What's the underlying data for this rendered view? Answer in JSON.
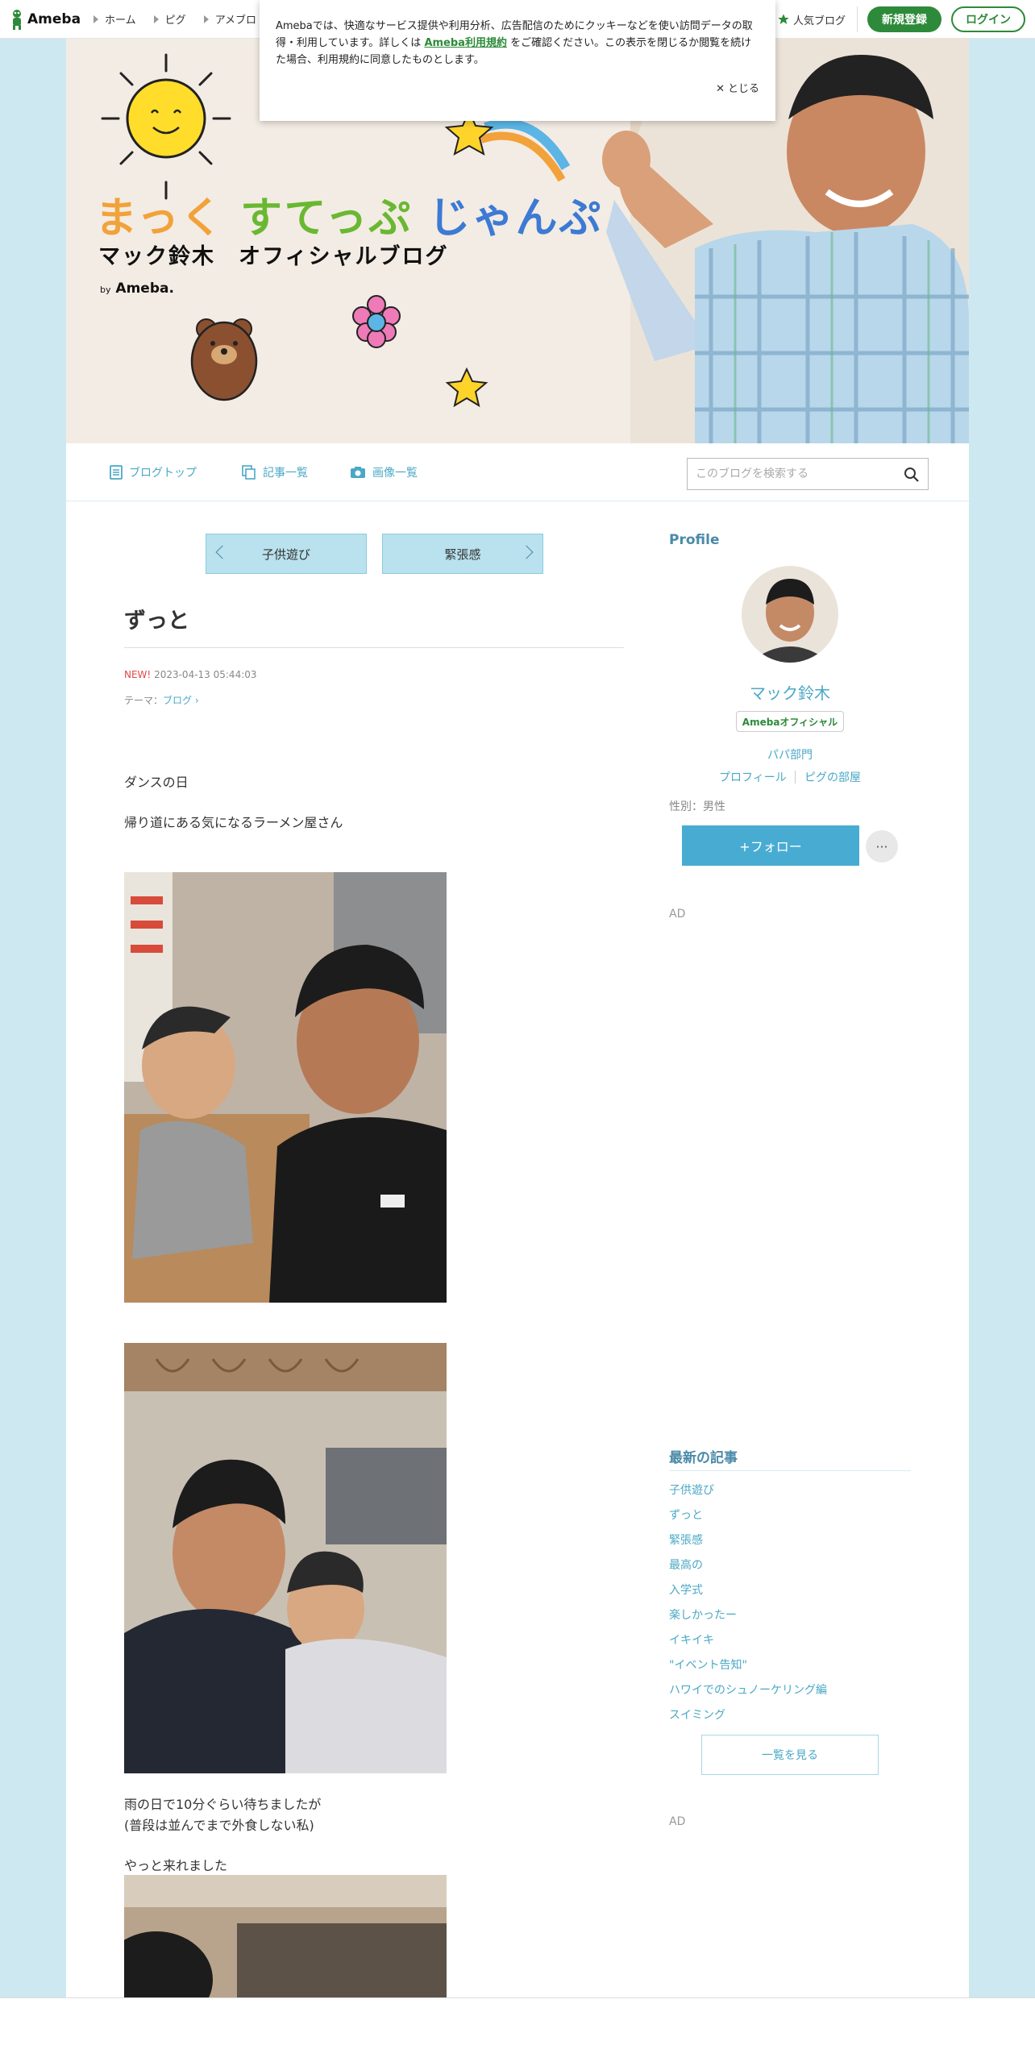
{
  "global_header": {
    "logo_text": "Ameba",
    "nav": [
      "ホーム",
      "ピグ",
      "アメブロ"
    ],
    "popular_blog": "人気ブログ",
    "signup": "新規登録",
    "login": "ログイン"
  },
  "cookie_banner": {
    "text_before": "Amebaでは、快適なサービス提供や利用分析、広告配信のためにクッキーなどを使い訪問データの取得・利用しています。詳しくは ",
    "link": "Ameba利用規約",
    "text_after": " をご確認ください。この表示を閉じるか閲覧を続けた場合、利用規約に同意したものとします。",
    "close": "とじる"
  },
  "hero": {
    "title_parts": [
      "まっく",
      "すてっぷ",
      "じゃんぷ"
    ],
    "subtitle": "マック鈴木　オフィシャルブログ",
    "by": "by",
    "brand": "Ameba."
  },
  "blog_nav": {
    "items": [
      "ブログトップ",
      "記事一覧",
      "画像一覧"
    ],
    "search_placeholder": "このブログを検索する"
  },
  "pager": {
    "prev": "子供遊び",
    "next": "緊張感"
  },
  "article": {
    "title": "ずっと",
    "new_label": "NEW!",
    "date": "2023-04-13 05:44:03",
    "theme_label": "テーマ：",
    "theme": "ブログ",
    "paragraphs": [
      "ダンスの日",
      "帰り道にある気になるラーメン屋さん",
      "雨の日で10分ぐらい待ちましたが",
      "(普段は並んでまで外食しない私)",
      "やっと来れました"
    ]
  },
  "sidebar": {
    "profile_heading": "Profile",
    "name": "マック鈴木",
    "badge": "Amebaオフィシャル",
    "category": "パパ部門",
    "links": [
      "プロフィール",
      "ピグの部屋"
    ],
    "gender": "性別：男性",
    "follow": "+フォロー",
    "more": "···",
    "ad_label": "AD",
    "recent_heading": "最新の記事",
    "recent": [
      "子供遊び",
      "ずっと",
      "緊張感",
      "最高の",
      "入学式",
      "楽しかったー",
      "イキイキ",
      "\"イベント告知\"",
      "ハワイでのシュノーケリング編",
      "スイミング"
    ],
    "see_all": "一覧を見る"
  },
  "colors": {
    "accent": "#48acd2",
    "brand_green": "#2d8a3a",
    "background": "#cde8f0"
  }
}
